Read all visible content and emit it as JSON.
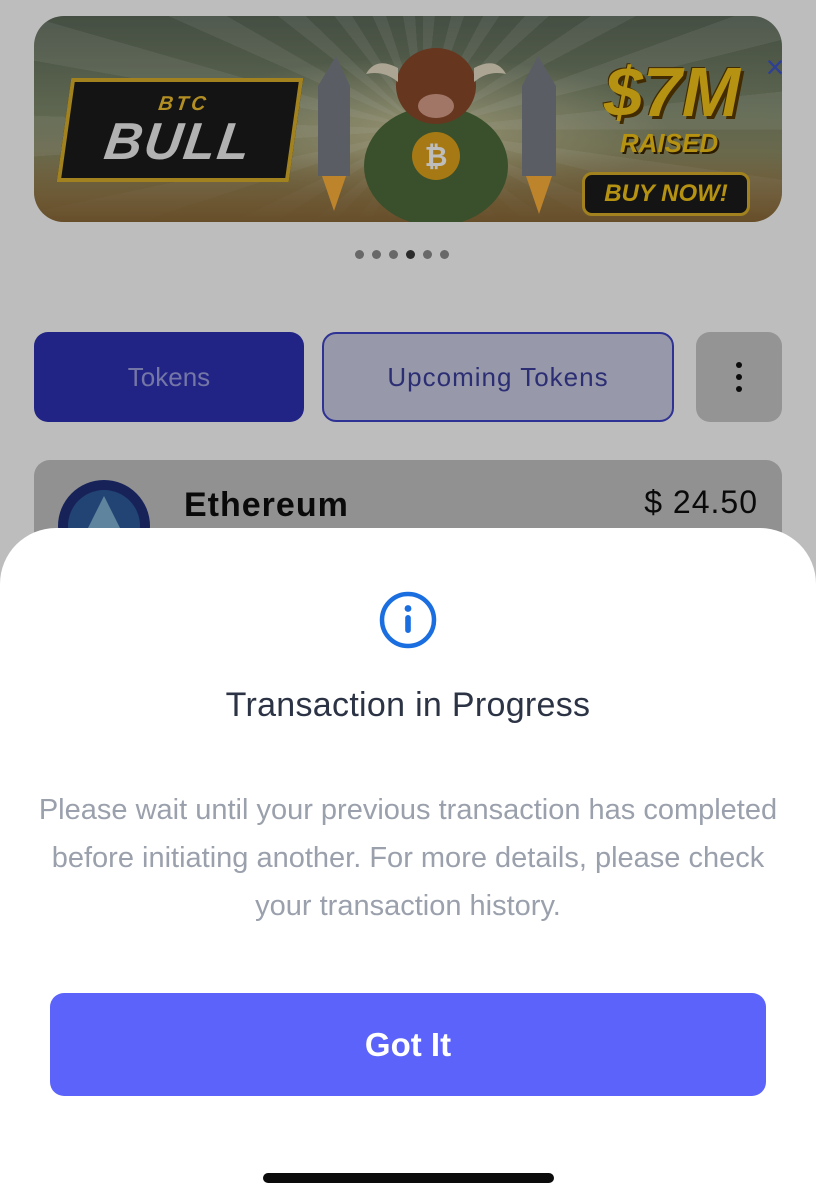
{
  "banner": {
    "logo_top": "BTC",
    "logo_main": "BULL",
    "raised_amount": "$7M",
    "raised_label": "RAISED",
    "cta_label": "BUY NOW!",
    "close_glyph": "×",
    "carousel_dots": 6,
    "active_dot_index": 3
  },
  "tabs": {
    "tokens_label": "Tokens",
    "upcoming_label": "Upcoming Tokens",
    "more_icon": "more-vertical-icon"
  },
  "token_row": {
    "name": "Ethereum",
    "value": "$ 24.50",
    "icon": "ethereum-icon"
  },
  "sheet": {
    "icon": "info-icon",
    "title": "Transaction in Progress",
    "message": "Please wait until your previous transaction has completed before initiating another. For more details, please check your transaction history.",
    "button_label": "Got It"
  },
  "colors": {
    "primary": "#5b63fb",
    "tab_active_bg": "#2d31b4",
    "info_icon": "#1a6ee0",
    "title_text": "#2b3345",
    "message_text": "#9aa0ac",
    "overlay": "rgba(0,0,0,0.26)"
  }
}
